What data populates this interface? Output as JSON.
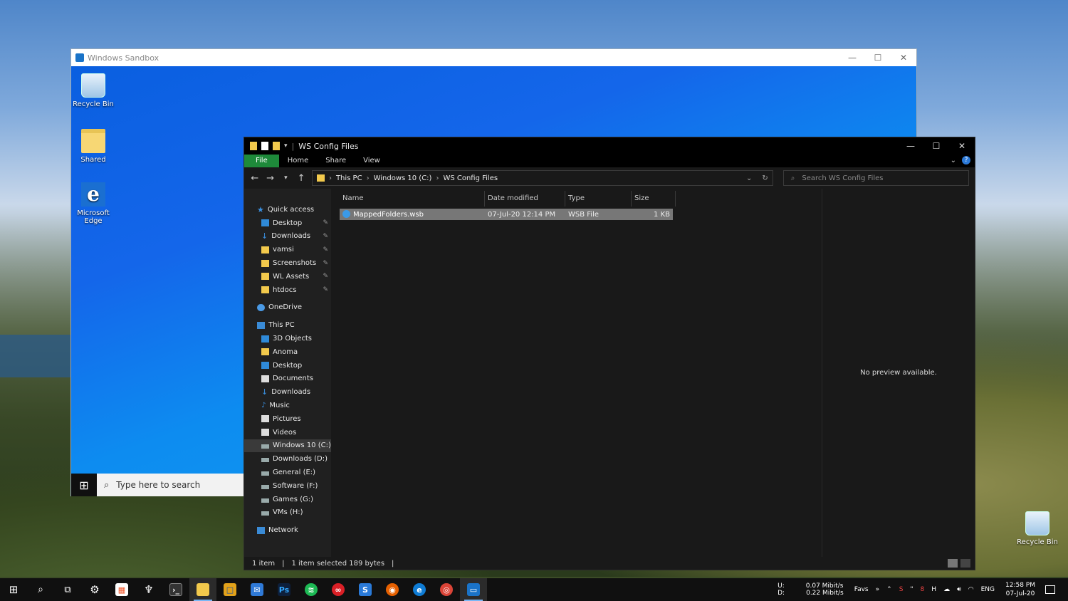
{
  "sandbox": {
    "title": "Windows Sandbox",
    "desktop_icons": [
      {
        "label": "Recycle Bin",
        "icon": "recycle-bin-icon"
      },
      {
        "label": "Shared",
        "icon": "folder-icon"
      },
      {
        "label": "Microsoft Edge",
        "icon": "edge-icon"
      }
    ],
    "search_placeholder": "Type here to search"
  },
  "explorer": {
    "title": "WS Config Files",
    "ribbon_tabs": [
      "File",
      "Home",
      "Share",
      "View"
    ],
    "breadcrumb": [
      "This PC",
      "Windows 10 (C:)",
      "WS Config Files"
    ],
    "search_placeholder": "Search WS Config Files",
    "nav": {
      "quick_access": "Quick access",
      "quick_items": [
        "Desktop",
        "Downloads",
        "vamsi",
        "Screenshots",
        "WL Assets",
        "htdocs"
      ],
      "onedrive": "OneDrive",
      "this_pc": "This PC",
      "pc_items": [
        "3D Objects",
        "Anoma",
        "Desktop",
        "Documents",
        "Downloads",
        "Music",
        "Pictures",
        "Videos",
        "Windows 10 (C:)",
        "Downloads  (D:)",
        "General (E:)",
        "Software (F:)",
        "Games (G:)",
        "VMs (H:)"
      ],
      "network": "Network"
    },
    "columns": [
      "Name",
      "Date modified",
      "Type",
      "Size"
    ],
    "files": [
      {
        "name": "MappedFolders.wsb",
        "date": "07-Jul-20 12:14 PM",
        "type": "WSB File",
        "size": "1 KB"
      }
    ],
    "preview_text": "No preview available.",
    "status": {
      "count": "1 item",
      "selected": "1 item selected  189 bytes"
    }
  },
  "desktop": {
    "recycle_bin": "Recycle Bin"
  },
  "taskbar": {
    "net": {
      "up_label": "U:",
      "up": "0.07 Mibit/s",
      "down_label": "D:",
      "down": "0.22 Mibit/s"
    },
    "favs": "Favs",
    "lang": "ENG",
    "time": "12:58 PM",
    "date": "07-Jul-20"
  }
}
